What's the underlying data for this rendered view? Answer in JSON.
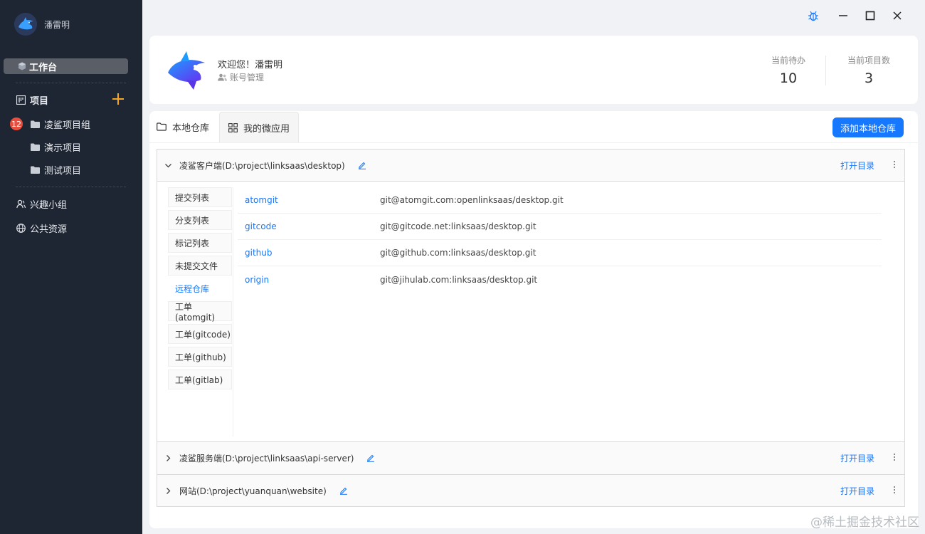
{
  "sidebar": {
    "user_name": "潘雷明",
    "workbench_label": "工作台",
    "projects_label": "项目",
    "badge_count": "12",
    "project_items": [
      {
        "label": "凌鲨项目组"
      },
      {
        "label": "演示项目"
      },
      {
        "label": "测试项目"
      }
    ],
    "interest_group_label": "兴趣小组",
    "public_resources_label": "公共资源"
  },
  "header": {
    "welcome": "欢迎您！潘雷明",
    "account_mgmt": "账号管理",
    "stats": [
      {
        "label": "当前待办",
        "value": "10"
      },
      {
        "label": "当前项目数",
        "value": "3"
      }
    ]
  },
  "tabs": [
    {
      "label": "本地仓库",
      "icon": "folder-icon"
    },
    {
      "label": "我的微应用",
      "icon": "app-grid-icon"
    }
  ],
  "add_repo_label": "添加本地仓库",
  "repos": [
    {
      "name": "凌鲨客户端(D:\\project\\linksaas\\desktop)",
      "open_label": "打开目录"
    },
    {
      "name": "凌鲨服务端(D:\\project\\linksaas\\api-server)",
      "open_label": "打开目录"
    },
    {
      "name": "网站(D:\\project\\yuanquan\\website)",
      "open_label": "打开目录"
    }
  ],
  "repo_subnav": [
    {
      "label": "提交列表"
    },
    {
      "label": "分支列表"
    },
    {
      "label": "标记列表"
    },
    {
      "label": "未提交文件"
    },
    {
      "label": "远程仓库"
    },
    {
      "label": "工单(atomgit)"
    },
    {
      "label": "工单(gitcode)"
    },
    {
      "label": "工单(github)"
    },
    {
      "label": "工单(gitlab)"
    }
  ],
  "remotes": [
    {
      "name": "atomgit",
      "url": "git@atomgit.com:openlinksaas/desktop.git"
    },
    {
      "name": "gitcode",
      "url": "git@gitcode.net:linksaas/desktop.git"
    },
    {
      "name": "github",
      "url": "git@github.com:linksaas/desktop.git"
    },
    {
      "name": "origin",
      "url": "git@jihulab.com:linksaas/desktop.git"
    }
  ],
  "watermark": "@稀土掘金技术社区",
  "colors": {
    "accent": "#1677ff",
    "sidebar_bg": "#1f2633",
    "badge": "#e84d3d",
    "plus": "#f5a623"
  }
}
